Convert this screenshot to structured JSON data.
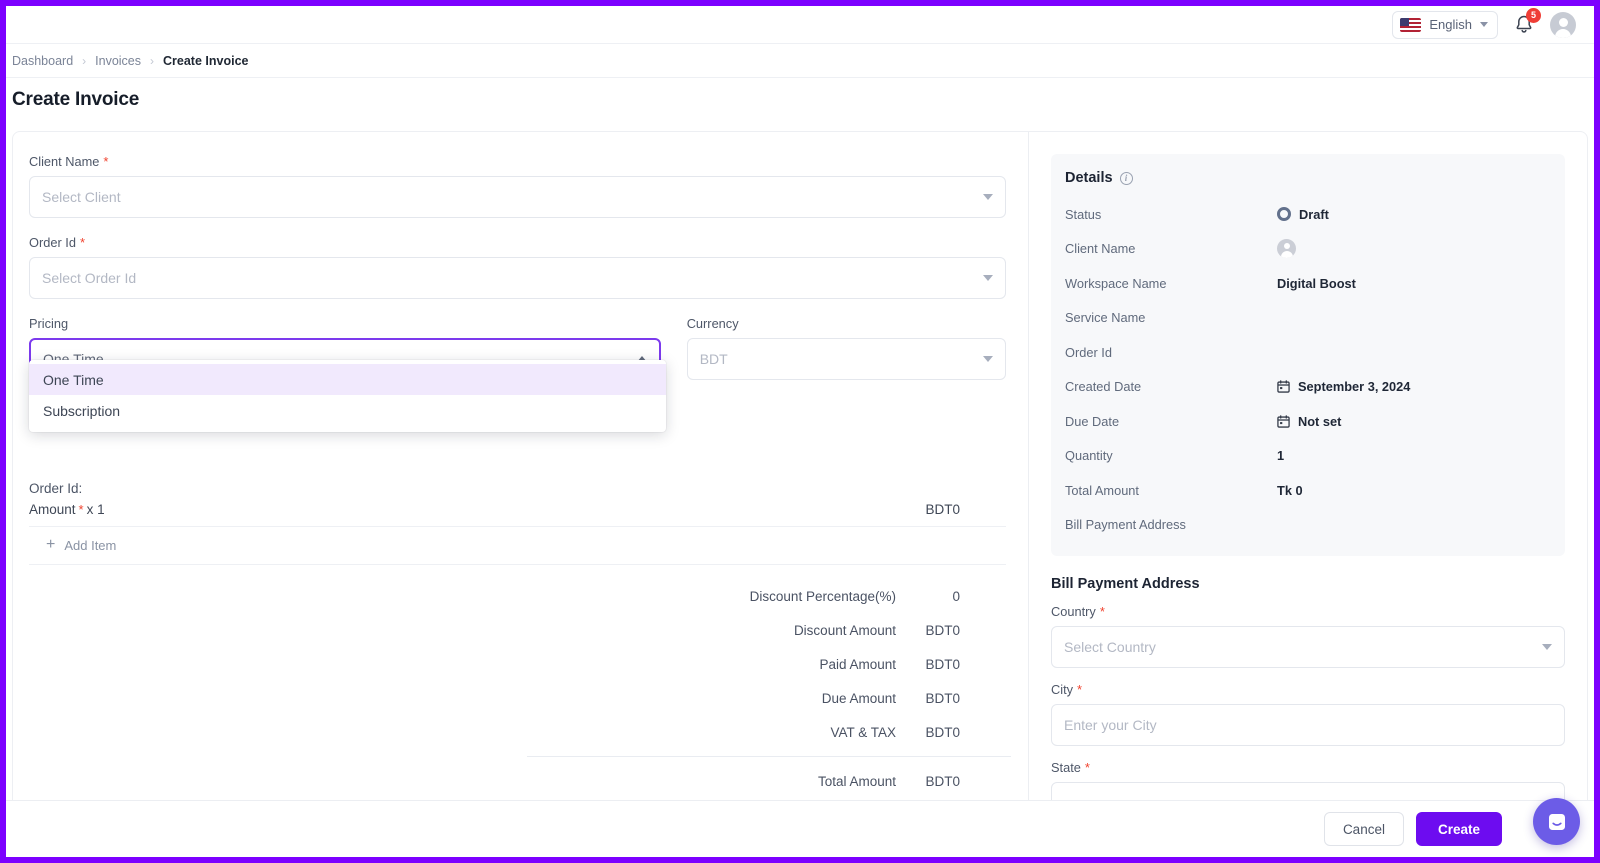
{
  "header": {
    "language": "English",
    "flag_icon": "us-flag-icon",
    "notification_icon": "bell-icon",
    "notification_count": "5",
    "avatar_icon": "user-avatar-icon",
    "chevron_icon": "chevron-down-icon"
  },
  "breadcrumb": {
    "items": [
      {
        "label": "Dashboard"
      },
      {
        "label": "Invoices"
      },
      {
        "label": "Create Invoice"
      }
    ],
    "separator": "›"
  },
  "page": {
    "title": "Create Invoice"
  },
  "form": {
    "client_name": {
      "label": "Client Name",
      "required": "*",
      "placeholder": "Select Client",
      "value": ""
    },
    "order_id": {
      "label": "Order Id",
      "required": "*",
      "placeholder": "Select Order Id",
      "value": ""
    },
    "pricing": {
      "label": "Pricing",
      "value": "One Time",
      "options": [
        {
          "label": "One Time",
          "selected": true
        },
        {
          "label": "Subscription",
          "selected": false
        }
      ]
    },
    "currency": {
      "label": "Currency",
      "value": "BDT"
    }
  },
  "items": {
    "order_id_line": "Order Id:",
    "amount_label": "Amount",
    "amount_required": "*",
    "amount_multiplier": "x 1",
    "amount_value": "BDT0",
    "add_item_label": "Add Item",
    "add_item_icon": "plus-icon"
  },
  "totals": {
    "rows": [
      {
        "label": "Discount Percentage(%)",
        "value": "0"
      },
      {
        "label": "Discount Amount",
        "value": "BDT0"
      },
      {
        "label": "Paid Amount",
        "value": "BDT0"
      },
      {
        "label": "Due Amount",
        "value": "BDT0"
      },
      {
        "label": "VAT & TAX",
        "value": "BDT0"
      }
    ],
    "total": {
      "label": "Total Amount",
      "value": "BDT0"
    }
  },
  "details": {
    "title": "Details",
    "info_icon": "info-icon",
    "rows": [
      {
        "key": "Status",
        "value": "Draft",
        "icon": "status-ring-icon"
      },
      {
        "key": "Client Name",
        "value": "",
        "icon": "user-avatar-icon"
      },
      {
        "key": "Workspace Name",
        "value": "Digital Boost",
        "icon": ""
      },
      {
        "key": "Service Name",
        "value": "",
        "icon": ""
      },
      {
        "key": "Order Id",
        "value": "",
        "icon": ""
      },
      {
        "key": "Created Date",
        "value": "September 3, 2024",
        "icon": "calendar-icon"
      },
      {
        "key": "Due Date",
        "value": "Not set",
        "icon": "calendar-icon"
      },
      {
        "key": "Quantity",
        "value": "1",
        "icon": ""
      },
      {
        "key": "Total Amount",
        "value": "Tk 0",
        "icon": ""
      },
      {
        "key": "Bill Payment Address",
        "value": "",
        "icon": ""
      }
    ]
  },
  "bill_payment_address": {
    "title": "Bill Payment Address",
    "country": {
      "label": "Country",
      "required": "*",
      "placeholder": "Select Country",
      "value": ""
    },
    "city": {
      "label": "City",
      "required": "*",
      "placeholder": "Enter your City",
      "value": ""
    },
    "state": {
      "label": "State",
      "required": "*",
      "placeholder": "",
      "value": ""
    }
  },
  "footer": {
    "cancel_label": "Cancel",
    "create_label": "Create"
  },
  "chat_widget": {
    "icon": "intercom-chat-icon"
  },
  "colors": {
    "accent": "#6d0cf0",
    "viewport_border": "#7c00ff",
    "focus": "#7c3aed",
    "required": "#f0432f",
    "badge": "#ef3e36",
    "chat": "#6c5ce7"
  }
}
